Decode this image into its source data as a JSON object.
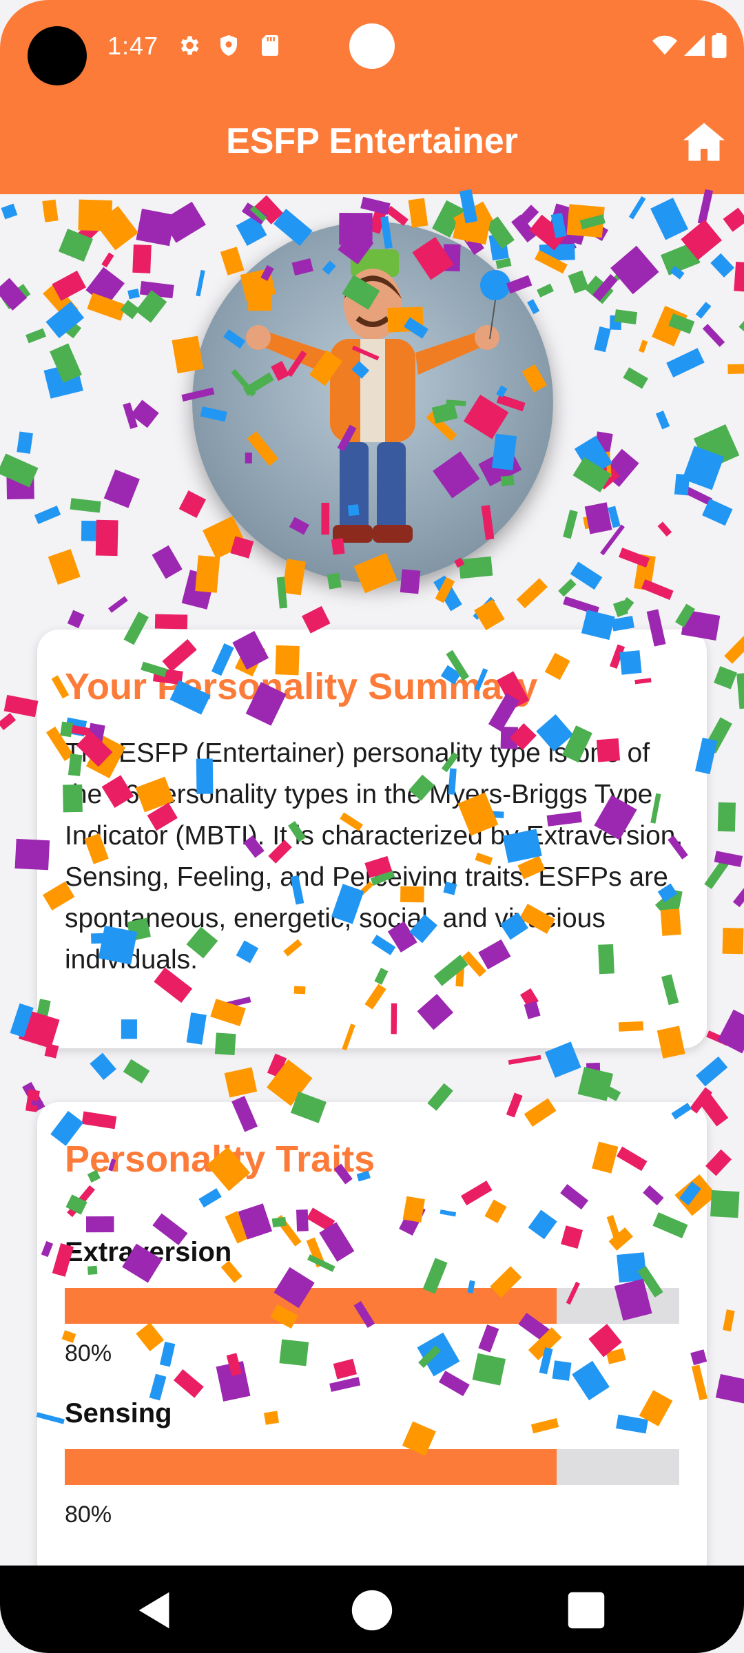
{
  "status_bar": {
    "time": "1:47",
    "icons": [
      "gear-icon",
      "shield-icon",
      "sd-card-icon",
      "wifi-icon",
      "signal-icon",
      "battery-icon"
    ]
  },
  "app_bar": {
    "title": "ESFP Entertainer",
    "home_icon": "home-icon"
  },
  "summary_card": {
    "title": "Your Personality Summary",
    "text": "The ESFP (Entertainer) personality type is one of the 16 personality types in the Myers-Briggs Type Indicator (MBTI). It is characterized by Extraversion, Sensing, Feeling, and Perceiving traits. ESFPs are spontaneous, energetic, social, and vivacious individuals."
  },
  "traits_card": {
    "title": "Personality Traits",
    "traits": [
      {
        "name": "Extraversion",
        "value": 0.8,
        "label": "80%"
      },
      {
        "name": "Sensing",
        "value": 0.8,
        "label": "80%"
      }
    ]
  },
  "nav_bar": {
    "icons": [
      "back-icon",
      "home-circle-icon",
      "recents-icon"
    ]
  },
  "colors": {
    "accent": "#fd7b38",
    "background": "#f3f2f5",
    "confetti": [
      "#e91e63",
      "#2196f3",
      "#ff9800",
      "#9c27b0",
      "#4caf50"
    ]
  }
}
